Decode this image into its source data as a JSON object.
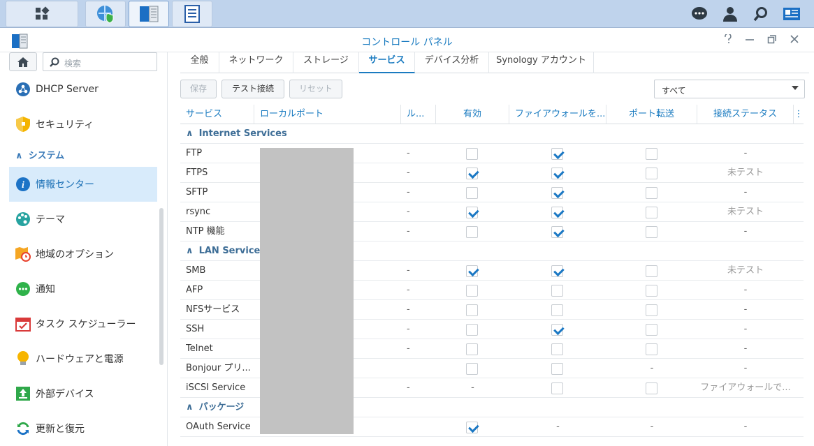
{
  "window": {
    "title": "コントロール パネル"
  },
  "sidebar": {
    "search_placeholder": "検索",
    "items": [
      {
        "label": "DHCP Server",
        "icon": "dhcp-icon"
      },
      {
        "label": "セキュリティ",
        "icon": "shield-icon"
      },
      {
        "label": "情報センター",
        "icon": "info-icon",
        "selected": true
      },
      {
        "label": "テーマ",
        "icon": "palette-icon"
      },
      {
        "label": "地域のオプション",
        "icon": "clock-map-icon"
      },
      {
        "label": "通知",
        "icon": "chat-icon"
      },
      {
        "label": "タスク スケジューラー",
        "icon": "calendar-icon"
      },
      {
        "label": "ハードウェアと電源",
        "icon": "bulb-icon"
      },
      {
        "label": "外部デバイス",
        "icon": "upload-icon"
      },
      {
        "label": "更新と復元",
        "icon": "refresh-icon"
      }
    ],
    "section_system": "システム"
  },
  "tabs": [
    "全般",
    "ネットワーク",
    "ストレージ",
    "サービス",
    "デバイス分析",
    "Synology アカウント"
  ],
  "active_tab": "サービス",
  "toolbar": {
    "save": "保存",
    "test": "テスト接続",
    "reset": "リセット",
    "filter": "すべて"
  },
  "columns": [
    "サービス",
    "ローカルポート",
    "ル...",
    "有効",
    "ファイアウォールを...",
    "ポート転送",
    "接続ステータス"
  ],
  "groups": {
    "internet": "Internet Services",
    "lan": "LAN Services",
    "package": "パッケージ"
  },
  "rows": [
    {
      "name": "FTP",
      "rule": "-",
      "enabled": false,
      "firewall": true,
      "portfw": false,
      "status": "-"
    },
    {
      "name": "FTPS",
      "rule": "-",
      "enabled": true,
      "firewall": true,
      "portfw": false,
      "status": "未テスト"
    },
    {
      "name": "SFTP",
      "rule": "-",
      "enabled": false,
      "firewall": true,
      "portfw": false,
      "status": "-"
    },
    {
      "name": "rsync",
      "rule": "-",
      "enabled": true,
      "firewall": true,
      "portfw": false,
      "status": "未テスト"
    },
    {
      "name": "NTP 機能",
      "rule": "-",
      "enabled": false,
      "firewall": true,
      "portfw": false,
      "status": "-"
    },
    {
      "name": "SMB",
      "rule": "-",
      "enabled": true,
      "firewall": true,
      "portfw": false,
      "status": "未テスト"
    },
    {
      "name": "AFP",
      "rule": "-",
      "enabled": false,
      "firewall": false,
      "portfw": false,
      "status": "-"
    },
    {
      "name": "NFSサービス",
      "rule": "-",
      "enabled": false,
      "firewall": false,
      "portfw": false,
      "status": "-"
    },
    {
      "name": "SSH",
      "rule": "-",
      "enabled": false,
      "firewall": true,
      "portfw": false,
      "status": "-"
    },
    {
      "name": "Telnet",
      "rule": "-",
      "enabled": false,
      "firewall": false,
      "portfw": false,
      "status": "-"
    },
    {
      "name": "Bonjour プリ...",
      "rule": "",
      "enabled": false,
      "firewall": false,
      "portfw_text": "-",
      "status": "-"
    },
    {
      "name": "iSCSI Service",
      "rule": "-",
      "enabled_text": "-",
      "firewall": false,
      "portfw": false,
      "status": "ファイアウォールで..."
    },
    {
      "name": "OAuth Service",
      "rule": "",
      "enabled": true,
      "firewall_text": "-",
      "portfw_text": "-",
      "status": "-"
    }
  ]
}
